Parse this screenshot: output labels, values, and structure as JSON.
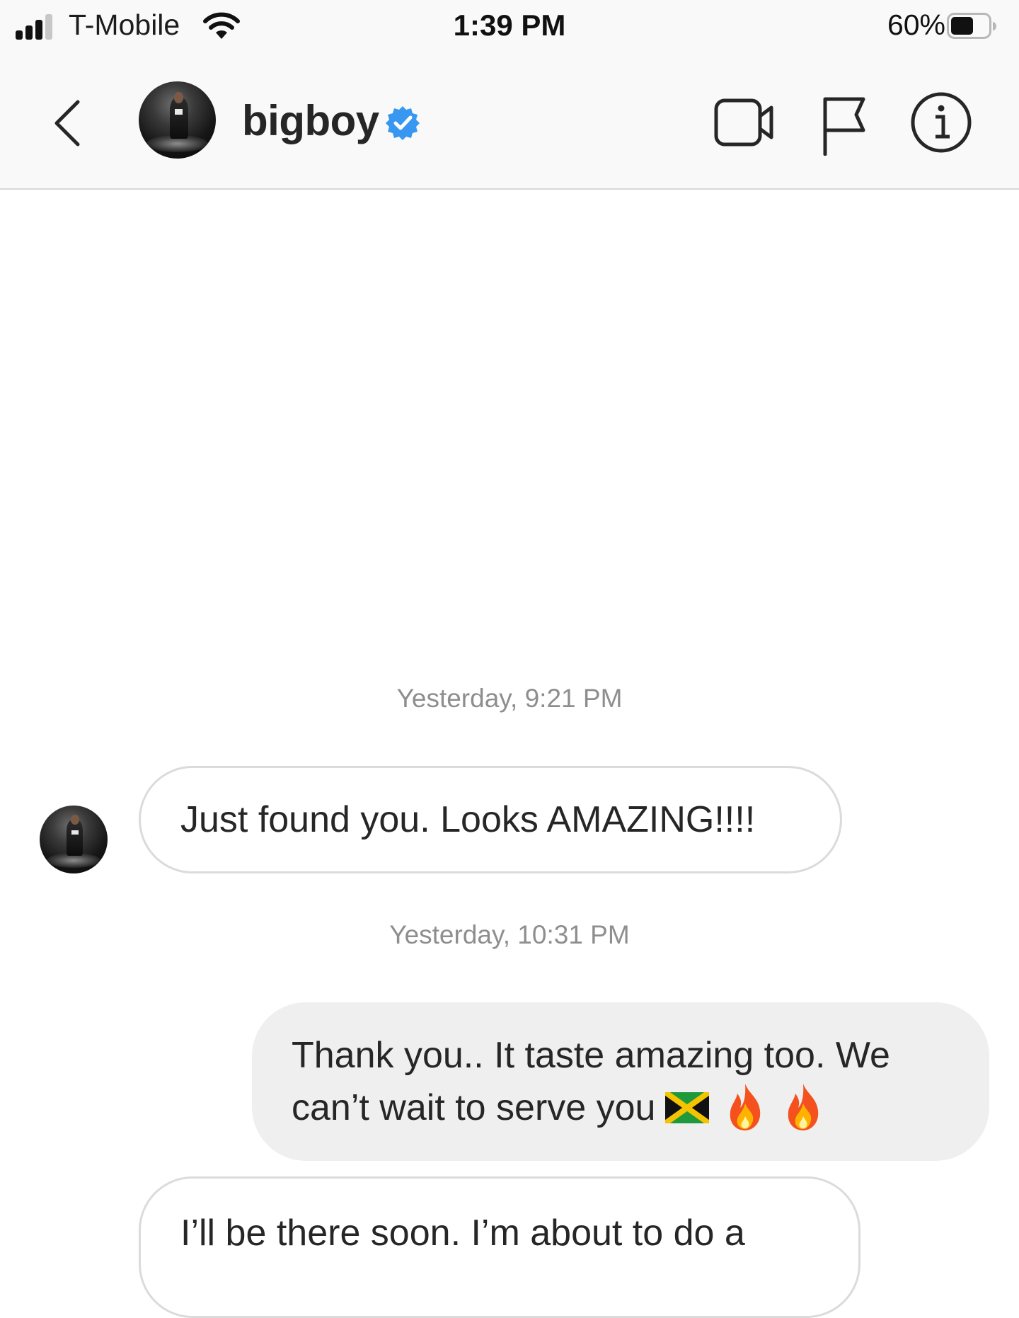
{
  "status_bar": {
    "carrier": "T-Mobile",
    "time": "1:39 PM",
    "battery_percent": "60%",
    "battery_level": 0.6,
    "signal_bars": 3
  },
  "header": {
    "username": "bigboy",
    "verified": true,
    "verified_badge_color": "#3897f0",
    "icons": [
      "back-chevron-icon",
      "video-call-icon",
      "report-flag-icon",
      "info-icon"
    ]
  },
  "thread": {
    "timestamp_1": "Yesterday, 9:21 PM",
    "message_1": "Just found you. Looks AMAZING!!!!",
    "timestamp_2": "Yesterday, 10:31 PM",
    "message_2_text": "Thank you.. It taste amazing too. We can’t wait to serve you",
    "message_2_emojis": [
      "jamaica-flag-emoji",
      "fire-emoji",
      "fire-emoji"
    ],
    "message_3": "I’ll be there soon. I’m about to do a"
  },
  "colors": {
    "incoming_bubble_border": "#dbdbdb",
    "outgoing_bubble_bg": "#efefef",
    "timestamp_text": "#8e8e8e",
    "header_bg": "#f9f9f9"
  }
}
